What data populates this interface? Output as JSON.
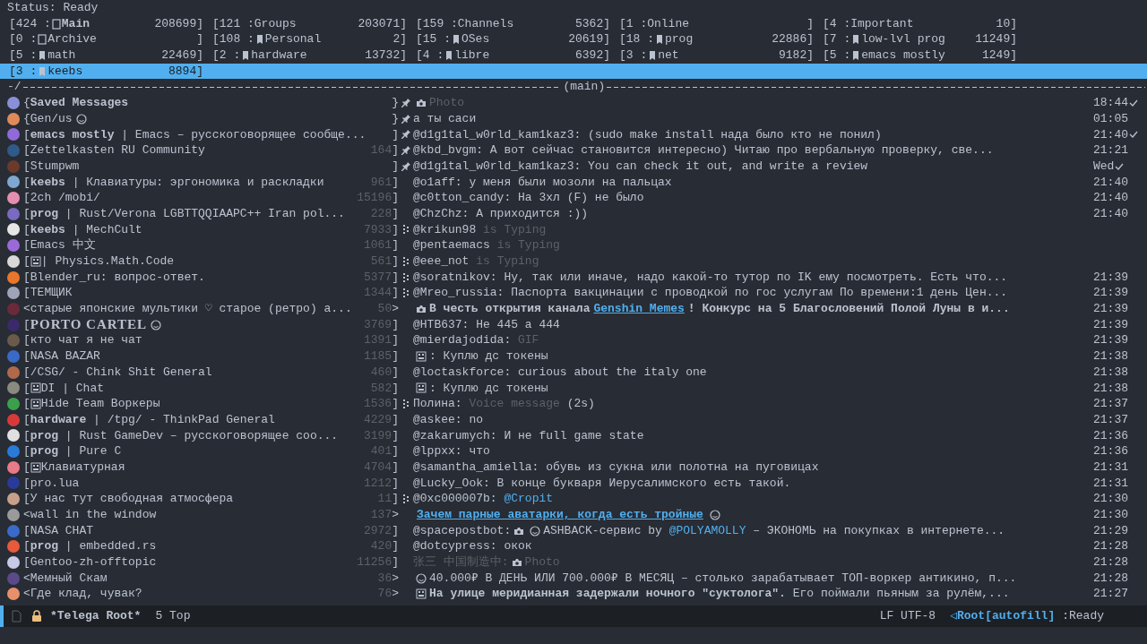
{
  "status_line": "Status: Ready",
  "folder_rows": [
    [
      {
        "prefix": "[424 :",
        "kind": "outline",
        "name": "Main",
        "bold": true,
        "count": "208699]",
        "selected": false
      },
      {
        "prefix": "[121 :",
        "kind": "none",
        "name": "Groups",
        "count": "203071]",
        "selected": false
      },
      {
        "prefix": "[159 :",
        "kind": "none",
        "name": "Channels",
        "count": "5362]",
        "selected": false
      },
      {
        "prefix": "[1 :",
        "kind": "none",
        "name": "Online",
        "count": "]",
        "selected": false
      },
      {
        "prefix": "[4 :",
        "kind": "none",
        "name": "Important",
        "count": "10]",
        "selected": false
      }
    ],
    [
      {
        "prefix": "[0 :",
        "kind": "outline",
        "name": "Archive",
        "count": "]",
        "selected": false
      },
      {
        "prefix": "[108 :",
        "kind": "tag",
        "name": "Personal",
        "count": "2]",
        "selected": false
      },
      {
        "prefix": "[15 :",
        "kind": "tag",
        "name": "OSes",
        "count": "20619]",
        "selected": false
      },
      {
        "prefix": "[18 :",
        "kind": "tag",
        "name": "prog",
        "count": "22886]",
        "selected": false
      },
      {
        "prefix": "[7 :",
        "kind": "tag",
        "name": "low-lvl prog",
        "count": "11249]",
        "selected": false
      }
    ],
    [
      {
        "prefix": "[5 :",
        "kind": "tag",
        "name": "math",
        "count": "22469]",
        "selected": false
      },
      {
        "prefix": "[2 :",
        "kind": "tag",
        "name": "hardware",
        "count": "13732]",
        "selected": false
      },
      {
        "prefix": "[4 :",
        "kind": "tag",
        "name": "libre",
        "count": "6392]",
        "selected": false
      },
      {
        "prefix": "[3 :",
        "kind": "tag",
        "name": "net",
        "count": "9182]",
        "selected": false
      },
      {
        "prefix": "[5 :",
        "kind": "tag",
        "name": "emacs mostly",
        "count": "1249]",
        "selected": false
      }
    ],
    [
      {
        "prefix": "[3 :",
        "kind": "tag",
        "name": "keebs",
        "count": "8894]",
        "selected": true
      }
    ]
  ],
  "divider": {
    "prefix": "-/",
    "label": "(main)"
  },
  "chats": [
    {
      "kind": "pinned",
      "color": "#8a90d8",
      "open": "{",
      "title": "**Saved Messages**",
      "close": "}",
      "message": [
        {
          "kind": "camera"
        },
        {
          "kind": "muted",
          "text": "Photo"
        }
      ],
      "time": "18:44",
      "read": true
    },
    {
      "kind": "pinned",
      "color": "#e08a5a",
      "open": "{",
      "title": "Gen/us",
      "title_suffix_glyph": true,
      "close": "}",
      "message": [
        {
          "kind": "text",
          "text": "а ты саси"
        }
      ],
      "time": "01:05"
    },
    {
      "kind": "pinned",
      "color": "#8f6ad8",
      "open": "[",
      "title": "**emacs mostly** | Emacs – русскоговорящее сообще...",
      "close": "]",
      "message": [
        {
          "kind": "text",
          "text": "@d1g1tal_w0rld_kam1kaz3: (sudo make install нада было кто не понил)"
        }
      ],
      "time": "21:40",
      "read": true
    },
    {
      "kind": "pinned",
      "color": "#2f5a8a",
      "open": "[",
      "title": "Zettelkasten RU Community",
      "count": "164",
      "close": "]",
      "message": [
        {
          "kind": "text",
          "text": "@kbd_bvgm: А вот сейчас становится интересно) Читаю про вербальную проверку, све..."
        }
      ],
      "time": "21:21"
    },
    {
      "kind": "pinned",
      "color": "#6b3a2a",
      "open": "[",
      "title": "Stumpwm",
      "close": "]",
      "message": [
        {
          "kind": "text",
          "text": "@d1g1tal_w0rld_kam1kaz3: You can check it out, and write a review"
        }
      ],
      "time": "Wed",
      "read": true
    },
    {
      "kind": "plain",
      "color": "#7fa8d0",
      "open": "[",
      "title": "**keebs** | Клавиатуры: эргономика и раскладки",
      "count": "961",
      "close": "]",
      "message": [
        {
          "kind": "text",
          "text": "@o1aff: у меня были мозоли на пальцах"
        }
      ],
      "time": "21:40"
    },
    {
      "kind": "plain",
      "color": "#e58fb0",
      "open": "[",
      "title": "2ch /mobi/",
      "count": "15196",
      "close": "]",
      "message": [
        {
          "kind": "text",
          "text": "@c0tton_candy: На 3хл (F) не было"
        }
      ],
      "time": "21:40"
    },
    {
      "kind": "plain",
      "color": "#7a6ac0",
      "open": "[",
      "title": "**prog** | Rust/Verona LGBTTQQIAAPC++ Iran pol...",
      "count": "228",
      "close": "]",
      "message": [
        {
          "kind": "text",
          "text": "@ChzChz: А приходится :))"
        }
      ],
      "time": "21:40"
    },
    {
      "kind": "dotted",
      "color": "#e6e6e6",
      "open": "[",
      "title": "**keebs** | MechCult",
      "count": "7933",
      "close": "]",
      "message": [
        {
          "kind": "text",
          "text": "@krikun98"
        },
        {
          "kind": "muted",
          "text": "is Typing"
        }
      ]
    },
    {
      "kind": "plain",
      "color": "#9a6ad8",
      "open": "[",
      "title": "Emacs 中文",
      "count": "1061",
      "close": "]",
      "message": [
        {
          "kind": "text",
          "text": "@pentaemacs"
        },
        {
          "kind": "muted",
          "text": "is Typing"
        }
      ]
    },
    {
      "kind": "dotted",
      "color": "#d8d8d8",
      "open": "[",
      "title_prefix_glyph": true,
      "title": " | Physics.Math.Code",
      "count": "561",
      "close": "]",
      "message": [
        {
          "kind": "text",
          "text": "@eee_not"
        },
        {
          "kind": "muted",
          "text": "is Typing"
        }
      ]
    },
    {
      "kind": "dotted",
      "color": "#e8762c",
      "open": "[",
      "title": "Blender_ru: вопрос-ответ.",
      "count": "5377",
      "close": "]",
      "message": [
        {
          "kind": "text",
          "text": "@soratnikov: Ну, так или иначе, надо какой-то тутор по IK ему посмотреть. Есть что..."
        }
      ],
      "time": "21:39"
    },
    {
      "kind": "dotted",
      "color": "#a0a4b8",
      "open": "[",
      "title": "ТЕМЩИК",
      "count": "1344",
      "close": "]",
      "message": [
        {
          "kind": "text",
          "text": "@Mreo_russia: Паспорта вакцинации с проводкой по гос услугам По времени:1 день Цен..."
        }
      ],
      "time": "21:39"
    },
    {
      "kind": "plain",
      "color": "#6a2a3a",
      "open": "<",
      "title": "старые японские мультики ♡ старое (ретро) а...",
      "count": "50",
      "close": ">",
      "message": [
        {
          "kind": "camera"
        },
        {
          "kind": "bold",
          "text": "В честь открытия канала"
        },
        {
          "kind": "link",
          "text": "Genshin Memes"
        },
        {
          "kind": "bold",
          "text": "! Конкурс на 5 Благословений Полой Луны в и..."
        }
      ],
      "time": "21:39"
    },
    {
      "kind": "plain",
      "color": "#3a2a6a",
      "open": "[",
      "title": "PORTO CARTEL",
      "serif": true,
      "title_suffix_glyph": true,
      "count": "3769",
      "close": "]",
      "message": [
        {
          "kind": "text",
          "text": "@HTB637: Не 445 а 444"
        }
      ],
      "time": "21:39"
    },
    {
      "kind": "plain",
      "color": "#6a5a4a",
      "open": "[",
      "title": "кто чат я не чат",
      "count": "1391",
      "close": "]",
      "message": [
        {
          "kind": "text",
          "text": "@mierdajodida:"
        },
        {
          "kind": "muted",
          "text": "GIF"
        }
      ],
      "time": "21:39"
    },
    {
      "kind": "plain",
      "color": "#3a6ac8",
      "open": "[",
      "title": "NASA BAZAR",
      "count": "1185",
      "close": "]",
      "message": [
        {
          "kind": "glyph"
        },
        {
          "kind": "text",
          "text": ": Куплю дс токены"
        }
      ],
      "time": "21:38"
    },
    {
      "kind": "plain",
      "color": "#b06a4a",
      "open": "[",
      "title": "/CSG/ - Chink Shit General",
      "count": "460",
      "close": "]",
      "message": [
        {
          "kind": "text",
          "text": "@loctaskforce: curious about the italy one"
        }
      ],
      "time": "21:38"
    },
    {
      "kind": "plain",
      "color": "#8a8a80",
      "open": "[",
      "title_prefix_glyph": true,
      "title": "DI | Chat",
      "count": "582",
      "close": "]",
      "message": [
        {
          "kind": "glyph"
        },
        {
          "kind": "text",
          "text": ": Куплю дс токены"
        }
      ],
      "time": "21:38"
    },
    {
      "kind": "dotted",
      "color": "#3aa04a",
      "open": "[",
      "title_prefix_glyph": true,
      "title": "Hide Team Воркеры",
      "count": "1536",
      "close": "]",
      "message": [
        {
          "kind": "text",
          "text": "Полина:"
        },
        {
          "kind": "muted",
          "text": "Voice message"
        },
        {
          "kind": "text",
          "text": "(2s)"
        }
      ],
      "time": "21:37"
    },
    {
      "kind": "plain",
      "color": "#d83a3a",
      "open": "[",
      "title": "**hardware** | /tpg/ - ThinkPad General",
      "count": "4229",
      "close": "]",
      "message": [
        {
          "kind": "text",
          "text": "@askee: no"
        }
      ],
      "time": "21:37"
    },
    {
      "kind": "plain",
      "color": "#e0e0e0",
      "open": "[",
      "title": "**prog** | Rust GameDev – русскоговорящее соо...",
      "count": "3199",
      "close": "]",
      "message": [
        {
          "kind": "text",
          "text": "@zakarumych: И не full game state"
        }
      ],
      "time": "21:36"
    },
    {
      "kind": "plain",
      "color": "#2a7ad8",
      "open": "[",
      "title": "**prog** | Pure C",
      "count": "401",
      "close": "]",
      "message": [
        {
          "kind": "text",
          "text": "@lppxx: что"
        }
      ],
      "time": "21:36"
    },
    {
      "kind": "plain",
      "color": "#e87a8a",
      "open": "[",
      "title_prefix_glyph": true,
      "title": "Клавиатурная",
      "count": "4704",
      "close": "]",
      "message": [
        {
          "kind": "text",
          "text": "@samantha_amiella: обувь из сукна или полотна на пуговицах"
        }
      ],
      "time": "21:31"
    },
    {
      "kind": "plain",
      "color": "#2a3a9a",
      "open": "[",
      "title": "pro.lua",
      "count": "1212",
      "close": "]",
      "message": [
        {
          "kind": "text",
          "text": "@Lucky_Ook: В конце букваря Иерусалимского есть такой."
        }
      ],
      "time": "21:31"
    },
    {
      "kind": "dotted",
      "color": "#c8a08a",
      "open": "[",
      "title": "У нас тут свободная атмосфера",
      "count": "11",
      "close": "]",
      "message": [
        {
          "kind": "text",
          "text": "@0xc000007b:"
        },
        {
          "kind": "mention",
          "text": "@Cropit"
        }
      ],
      "time": "21:30"
    },
    {
      "kind": "plain",
      "color": "#9a9a9a",
      "open": "<",
      "title": "wall in the window",
      "count": "137",
      "close": ">",
      "message": [
        {
          "kind": "link",
          "text": "Зачем парные аватарки, когда есть тройные"
        },
        {
          "kind": "emoji"
        }
      ],
      "time": "21:30"
    },
    {
      "kind": "plain",
      "color": "#3a6ac8",
      "open": "[",
      "title": "NASA CHAT",
      "count": "2972",
      "close": "]",
      "message": [
        {
          "kind": "text",
          "text": "@spacepostbot:"
        },
        {
          "kind": "camera"
        },
        {
          "kind": "emoji"
        },
        {
          "kind": "text",
          "text": "ASHBACK-сервис by"
        },
        {
          "kind": "mention",
          "text": "@POLYAMOLLY"
        },
        {
          "kind": "text",
          "text": "– ЭКОНОМЬ на покупках в интернете..."
        }
      ],
      "time": "21:29"
    },
    {
      "kind": "plain",
      "color": "#e85a3a",
      "open": "[",
      "title": "**prog** | embedded.rs",
      "count": "420",
      "close": "]",
      "message": [
        {
          "kind": "text",
          "text": "@dotcypress: окок"
        }
      ],
      "time": "21:28"
    },
    {
      "kind": "plain",
      "color": "#c8c8e8",
      "open": "[",
      "title": "Gentoo-zh-offtopic",
      "count": "11256",
      "close": "]",
      "message": [
        {
          "kind": "muted",
          "text": "张三 中国制造中:"
        },
        {
          "kind": "camera"
        },
        {
          "kind": "muted",
          "text": "Photo"
        }
      ],
      "time": "21:28"
    },
    {
      "kind": "plain",
      "color": "#5a4a8a",
      "open": "<",
      "title": "Мемный Скам",
      "count": "36",
      "close": ">",
      "message": [
        {
          "kind": "emoji"
        },
        {
          "kind": "text",
          "text": "40.000₽ В ДЕНЬ ИЛИ 700.000₽ В МЕСЯЦ – столько зарабатывает ТОП-воркер антикино, п..."
        }
      ],
      "time": "21:28"
    },
    {
      "kind": "plain",
      "color": "#e8906a",
      "open": "<",
      "title": "Где клад, чувак?",
      "count": "76",
      "close": ">",
      "message": [
        {
          "kind": "glyph"
        },
        {
          "kind": "bold",
          "text": "На улице меридианная задержали ночного \"суктолога\"."
        },
        {
          "kind": "text",
          "text": "Его поймали пьяным за рулём,..."
        }
      ],
      "time": "21:27"
    }
  ],
  "modeline": {
    "buffer": "*Telega Root*",
    "position": "5 Top",
    "encoding": "LF UTF-8",
    "mode": "◁Root[autofill]",
    "state": ":Ready"
  }
}
